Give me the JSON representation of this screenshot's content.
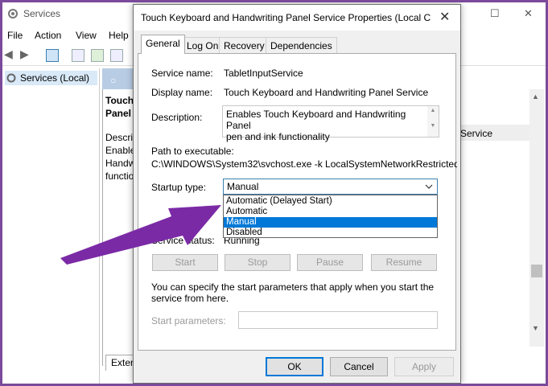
{
  "services_window": {
    "title": "Services",
    "menu": [
      "File",
      "Action",
      "View",
      "Help"
    ],
    "tree_item": "Services (Local)",
    "pane_title_lines": [
      "Touch",
      "Panel"
    ],
    "pane_desc_lines": [
      "Descri",
      "Enable",
      "Handw",
      "functio"
    ],
    "column_text": "Service",
    "bottom_tab": "Exten"
  },
  "dialog": {
    "title": "Touch Keyboard and Handwriting Panel Service Properties (Local C...",
    "tabs": [
      "General",
      "Log On",
      "Recovery",
      "Dependencies"
    ],
    "service_name_label": "Service name:",
    "service_name": "TabletInputService",
    "display_name_label": "Display name:",
    "display_name": "Touch Keyboard and Handwriting Panel Service",
    "description_label": "Description:",
    "description_lines": [
      "Enables Touch Keyboard and Handwriting Panel",
      "pen and ink functionality"
    ],
    "path_label": "Path to executable:",
    "path": "C:\\WINDOWS\\System32\\svchost.exe -k LocalSystemNetworkRestricted -p",
    "startup_label": "Startup type:",
    "startup_value": "Manual",
    "startup_options": [
      "Automatic (Delayed Start)",
      "Automatic",
      "Manual",
      "Disabled"
    ],
    "startup_selected": "Manual",
    "status_label": "Service status:",
    "status_value": "Running",
    "service_buttons": [
      "Start",
      "Stop",
      "Pause",
      "Resume"
    ],
    "params_hint": "You can specify the start parameters that apply when you start the service from here.",
    "params_label": "Start parameters:",
    "params_value": "",
    "ok": "OK",
    "cancel": "Cancel",
    "apply": "Apply"
  },
  "colors": {
    "accent": "#0078d7",
    "arrow": "#7b2aa6",
    "border": "#7a4a9b"
  },
  "icons": [
    "services-icon",
    "minimize-icon",
    "maximize-icon",
    "close-icon",
    "back-icon",
    "forward-icon",
    "chevron-down-icon",
    "annotation-arrow-icon"
  ]
}
